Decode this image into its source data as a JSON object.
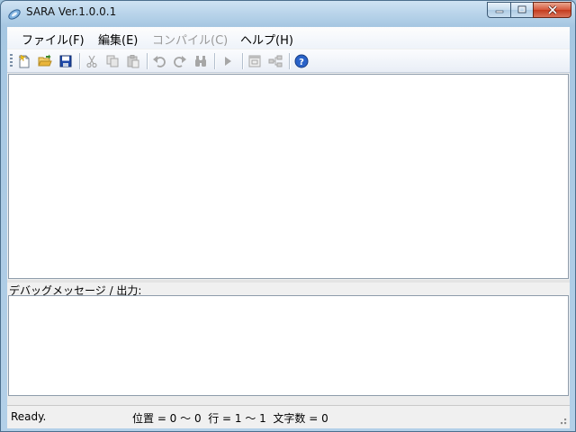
{
  "window": {
    "title": "SARA Ver.1.0.0.1"
  },
  "menubar": {
    "items": [
      {
        "label": "ファイル(F)",
        "enabled": true
      },
      {
        "label": "編集(E)",
        "enabled": true
      },
      {
        "label": "コンパイル(C)",
        "enabled": false
      },
      {
        "label": "ヘルプ(H)",
        "enabled": true
      }
    ]
  },
  "toolbar": {
    "buttons": [
      {
        "icon": "new-file-icon",
        "enabled": true
      },
      {
        "icon": "open-folder-icon",
        "enabled": true
      },
      {
        "icon": "save-icon",
        "enabled": true
      },
      {
        "icon": "cut-icon",
        "enabled": false
      },
      {
        "icon": "copy-icon",
        "enabled": false
      },
      {
        "icon": "paste-icon",
        "enabled": false
      },
      {
        "icon": "undo-icon",
        "enabled": false
      },
      {
        "icon": "redo-icon",
        "enabled": false
      },
      {
        "icon": "find-icon",
        "enabled": false
      },
      {
        "icon": "run-icon",
        "enabled": false
      },
      {
        "icon": "window-icon",
        "enabled": false
      },
      {
        "icon": "tree-icon",
        "enabled": false
      },
      {
        "icon": "help-icon",
        "enabled": true
      }
    ]
  },
  "editor": {
    "content": ""
  },
  "debug": {
    "label": "デバッグメッセージ / 出力:",
    "content": ""
  },
  "status": {
    "ready": "Ready.",
    "position": "位置 = 0 〜 0  行 = 1 〜 1  文字数 = 0"
  },
  "colors": {
    "help_blue": "#2a63c9",
    "save_blue": "#1d47a8",
    "folder_yellow": "#e9b53c",
    "close_red": "#c33b1e"
  }
}
